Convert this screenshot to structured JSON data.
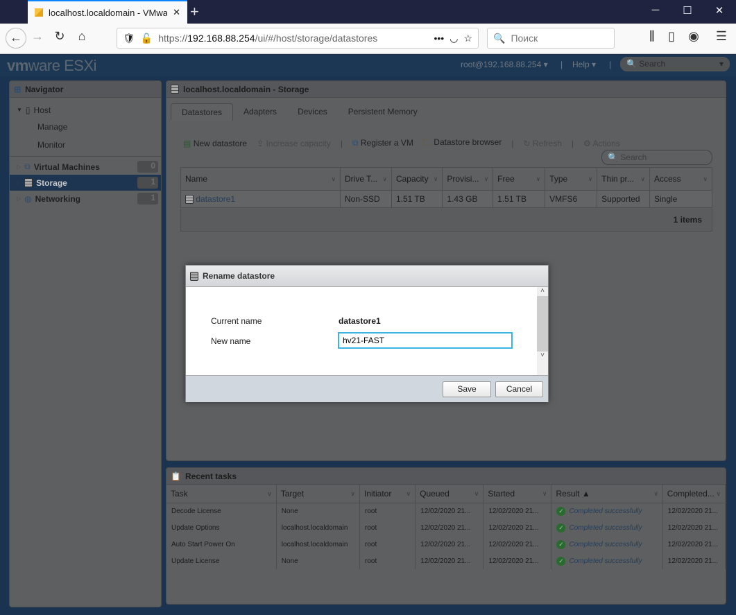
{
  "browser": {
    "tab_title": "localhost.localdomain - VMware ESXi",
    "new_tab": "+",
    "url_host": "192.168.88.254",
    "url_prefix": "https://",
    "url_path": "/ui/#/host/storage/datastores",
    "search_placeholder": "Поиск",
    "more": "•••"
  },
  "app": {
    "logo_bold": "vm",
    "logo_rest": "ware",
    "product": "ESXi",
    "user": "root@192.168.88.254 ▾",
    "help": "Help ▾",
    "search_placeholder": "Search"
  },
  "navigator": {
    "title": "Navigator",
    "host": "Host",
    "manage": "Manage",
    "monitor": "Monitor",
    "items": [
      {
        "label": "Virtual Machines",
        "count": "0"
      },
      {
        "label": "Storage",
        "count": "1"
      },
      {
        "label": "Networking",
        "count": "1"
      }
    ]
  },
  "storage": {
    "title": "localhost.localdomain - Storage",
    "tabs": [
      "Datastores",
      "Adapters",
      "Devices",
      "Persistent Memory"
    ],
    "toolbar": {
      "new": "New datastore",
      "increase": "Increase capacity",
      "register": "Register a VM",
      "browser": "Datastore browser",
      "refresh": "Refresh",
      "actions": "Actions"
    },
    "search_placeholder": "Search",
    "columns": [
      "Name",
      "Drive T...",
      "Capacity",
      "Provisi...",
      "Free",
      "Type",
      "Thin pr...",
      "Access"
    ],
    "rows": [
      [
        "datastore1",
        "Non-SSD",
        "1.51 TB",
        "1.43 GB",
        "1.51 TB",
        "VMFS6",
        "Supported",
        "Single"
      ]
    ],
    "footer": "1 items"
  },
  "tasks": {
    "title": "Recent tasks",
    "columns": [
      "Task",
      "Target",
      "Initiator",
      "Queued",
      "Started",
      "Result ▲",
      "Completed..."
    ],
    "rows": [
      [
        "Decode License",
        "None",
        "root",
        "12/02/2020 21...",
        "12/02/2020 21...",
        "Completed successfully",
        "12/02/2020 21..."
      ],
      [
        "Update Options",
        "localhost.localdomain",
        "root",
        "12/02/2020 21...",
        "12/02/2020 21...",
        "Completed successfully",
        "12/02/2020 21..."
      ],
      [
        "Auto Start Power On",
        "localhost.localdomain",
        "root",
        "12/02/2020 21...",
        "12/02/2020 21...",
        "Completed successfully",
        "12/02/2020 21..."
      ],
      [
        "Update License",
        "None",
        "root",
        "12/02/2020 21...",
        "12/02/2020 21...",
        "Completed successfully",
        "12/02/2020 21..."
      ]
    ]
  },
  "dialog": {
    "title": "Rename datastore",
    "current_label": "Current name",
    "current_value": "datastore1",
    "new_label": "New name",
    "new_value": "hv21-FAST",
    "save": "Save",
    "cancel": "Cancel"
  }
}
